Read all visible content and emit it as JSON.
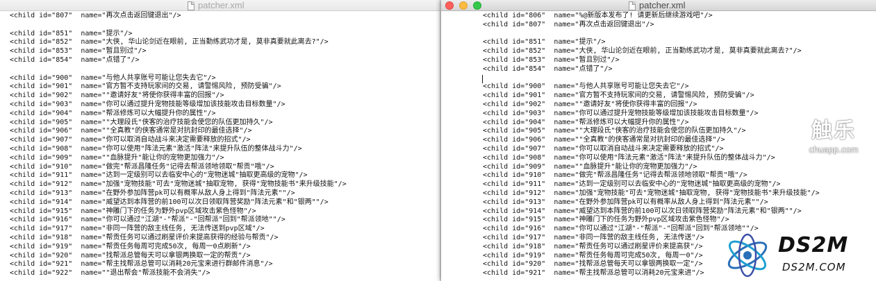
{
  "left_window": {
    "title": "patcher.xml",
    "lines": [
      "<child id=\"807\"  name=\"再次点击返回键退出\"/>",
      "",
      "<child id=\"851\"  name=\"提示\"/>",
      "<child id=\"852\"  name=\"大侠, 华山论剑近在眼前, 正当勤练武功才是, 莫非真要就此离去?\"/>",
      "<child id=\"853\"  name=\"暂且别过\"/>",
      "<child id=\"854\"  name=\"点错了\"/>",
      "",
      "<child id=\"900\"  name=\"与他人共享账号可能让您失去它\"/>",
      "<child id=\"901\"  name=\"官方暂不支持玩家间的交易, 请警惕风险, 预防受骗\"/>",
      "<child id=\"902\"  name=\"\"邀请好友\"将使你获得丰富的回报\"/>",
      "<child id=\"903\"  name=\"你可以通过提升宠物技能等级增加该技能攻击目标数量\"/>",
      "<child id=\"904\"  name=\"帮派修炼可以大幅提升你的属性\"/>",
      "<child id=\"905\"  name=\"\"大理段氏\"侠客的治疗技能会使您的队伍更加持久\"/>",
      "<child id=\"906\"  name=\"\"全真教\"的侠客通常是对抗封印的最佳选择\"/>",
      "<child id=\"907\"  name=\"你可以取消自动战斗来决定需要释放的招式\"/>",
      "<child id=\"908\"  name=\"你可以使用\"阵法元素\"激活\"阵法\"来提升队伍的整体战斗力\"/>",
      "<child id=\"909\"  name=\"\"血脉提升\"能让你的宠物更加强力\"/>",
      "<child id=\"910\"  name=\"做完\"帮派昌隆任务\"记得去帮派领地领取\"帮贡\"哦\"/>",
      "<child id=\"911\"  name=\"达到一定级别可以去临安中心的\"宠物迷城\"抽取更高级的宠物\"/>",
      "<child id=\"912\"  name=\"加强\"宠物技能\"可去\"宠物迷城\"抽取宠物, 获得\"宠物技能书\"来升级技能\"/>",
      "<child id=\"913\"  name=\"在野外参加阵营pk可以有概率从敌人身上得到\"阵法元素\"\"/>",
      "<child id=\"914\"  name=\"威望达到本阵营的前100可以次日领取阵营奖励\"阵法元素\"和\"银两\"\"/>",
      "<child id=\"915\"  name=\"神雕门下的任务为野外pvp区域攻击紫色怪物\"/>",
      "<child id=\"916\"  name=\"你可以通过\"江湖\"-\"帮派\"-\"回帮派\"回到\"帮派领地\"\"/>",
      "<child id=\"917\"  name=\"非同一阵营的敌主线任务, 无法传送到pvp区域\"/>",
      "<child id=\"918\"  name=\"帮贡任务可以通过刷星评价来提高获得的经验与帮贡\"/>",
      "<child id=\"919\"  name=\"帮贡任务每周可完成50次, 每周一0点刷新\"/>",
      "<child id=\"920\"  name=\"找帮派总管每天可以拿银两换取一定的帮贡\"/>",
      "<child id=\"921\"  name=\"帮主找帮派总管可以消耗20元宝来进行群邮件消息\"/>",
      "<child id=\"922\"  name=\"\"退出帮会\"帮派技能不会消失\"/>"
    ]
  },
  "right_window": {
    "title": "patcher.xml",
    "lines": [
      "<child id=\"806\"  name=\"%@新版本发布了! 请更新后继续游戏吧\"/>",
      "<child id=\"807\"  name=\"再次点击返回键退出\"/>",
      "",
      "<child id=\"851\"  name=\"提示\"/>",
      "<child id=\"852\"  name=\"大侠, 华山论剑近在眼前, 正当勤练武功才是, 莫非真要就此离去?\"/>",
      "<child id=\"853\"  name=\"暂且别过\"/>",
      "<child id=\"854\"  name=\"点错了\"/>",
      "",
      "<child id=\"900\"  name=\"与他人共享账号可能让您失去它\"/>",
      "<child id=\"901\"  name=\"官方暂不支持玩家间的交易, 请警惕风险, 预防受骗\"/>",
      "<child id=\"902\"  name=\"\"邀请好友\"将使你获得丰富的回报\"/>",
      "<child id=\"903\"  name=\"你可以通过提升宠物技能等级增加该技能攻击目标数量\"/>",
      "<child id=\"904\"  name=\"帮派修炼可以大幅提升你的属性\"/>",
      "<child id=\"905\"  name=\"\"大理段氏\"侠客的治疗技能会使您的队伍更加持久\"/>",
      "<child id=\"906\"  name=\"\"全真教\"的侠客通常是对抗封印的最佳选择\"/>",
      "<child id=\"907\"  name=\"你可以取消自动战斗来决定需要释放的招式\"/>",
      "<child id=\"908\"  name=\"你可以使用\"阵法元素\"激活\"阵法\"来提升队伍的整体战斗力\"/>",
      "<child id=\"909\"  name=\"\"血脉提升\"能让你的宠物更加强力\"/>",
      "<child id=\"910\"  name=\"做完\"帮派昌隆任务\"记得去帮派领地领取\"帮贡\"哦\"/>",
      "<child id=\"911\"  name=\"达到一定级别可以去临安中心的\"宠物迷城\"抽取更高级的宠物\"/>",
      "<child id=\"912\"  name=\"加强\"宠物技能\"可去\"宠物迷城\"抽取宠物, 获得\"宠物技能书\"来升级技能\"/>",
      "<child id=\"913\"  name=\"在野外参加阵营pk可以有概率从敌人身上得到\"阵法元素\"\"/>",
      "<child id=\"914\"  name=\"威望达到本阵营的前100可以次日领取阵营奖励\"阵法元素\"和\"银两\"\"/>",
      "<child id=\"915\"  name=\"神雕门下的任务为野外pvp区域攻击紫色怪物\"/>",
      "<child id=\"916\"  name=\"你可以通过\"江湖\"-\"帮派\"-\"回帮派\"回到\"帮派领地\"\"/>",
      "<child id=\"917\"  name=\"非同一阵营的敌主线任务, 无法传送\"/>",
      "<child id=\"918\"  name=\"帮贡任务可以通过刷星评价来提高获\"/>",
      "<child id=\"919\"  name=\"帮贡任务每周可完成50次, 每周一0\"/>",
      "<child id=\"920\"  name=\"找帮派总管每天可以拿银两换取一定\"/>",
      "<child id=\"921\"  name=\"帮主找帮派总管可以消耗20元宝来进\"/>"
    ]
  },
  "watermarks": {
    "chuapp_title": "触乐",
    "chuapp_url": "chuapp.com",
    "ds2m_title": "DS2M",
    "ds2m_url": "DS2M.COM"
  }
}
